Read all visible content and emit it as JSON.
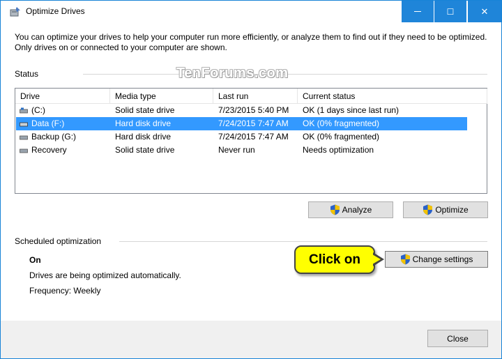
{
  "window": {
    "title": "Optimize Drives",
    "minimize_glyph": "—",
    "maximize_glyph": "☐",
    "close_glyph": "✕"
  },
  "intro": "You can optimize your drives to help your computer run more efficiently, or analyze them to find out if they need to be optimized. Only drives on or connected to your computer are shown.",
  "status": {
    "label": "Status",
    "watermark": "TenForums.com",
    "columns": [
      "Drive",
      "Media type",
      "Last run",
      "Current status"
    ],
    "rows": [
      {
        "drive": "(C:)",
        "media": "Solid state drive",
        "last_run": "7/23/2015 5:40 PM",
        "status": "OK (1 days since last run)",
        "selected": false
      },
      {
        "drive": "Data (F:)",
        "media": "Hard disk drive",
        "last_run": "7/24/2015 7:47 AM",
        "status": "OK (0% fragmented)",
        "selected": true
      },
      {
        "drive": "Backup (G:)",
        "media": "Hard disk drive",
        "last_run": "7/24/2015 7:47 AM",
        "status": "OK (0% fragmented)",
        "selected": false
      },
      {
        "drive": "Recovery",
        "media": "Solid state drive",
        "last_run": "Never run",
        "status": "Needs optimization",
        "selected": false
      }
    ],
    "analyze_label": "Analyze",
    "optimize_label": "Optimize"
  },
  "scheduled": {
    "label": "Scheduled optimization",
    "state": "On",
    "description": "Drives are being optimized automatically.",
    "frequency": "Frequency: Weekly",
    "change_settings_label": "Change settings",
    "callout": "Click on"
  },
  "footer": {
    "close_label": "Close"
  },
  "colors": {
    "titlebar_button": "#1f85d9",
    "selection": "#3399ff",
    "callout": "#ffff00"
  },
  "icons": [
    "optimize-drives-app-icon",
    "drive-icon",
    "uac-shield-icon"
  ]
}
